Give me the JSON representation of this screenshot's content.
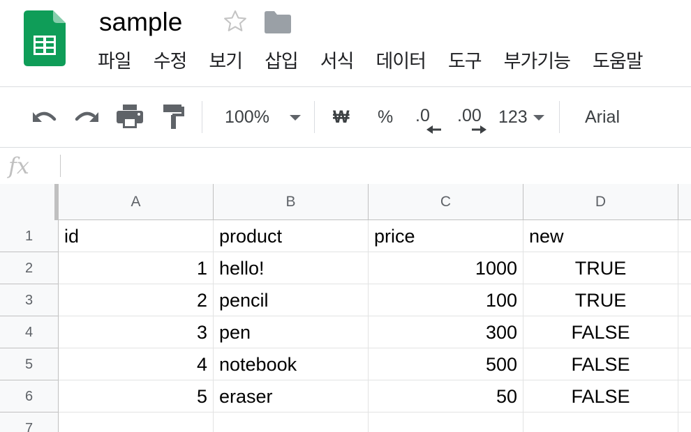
{
  "document": {
    "title": "sample"
  },
  "menu": [
    "파일",
    "수정",
    "보기",
    "삽입",
    "서식",
    "데이터",
    "도구",
    "부가기능",
    "도움말"
  ],
  "toolbar": {
    "zoom": "100%",
    "currency": "₩",
    "percent": "%",
    "decrease_decimal": ".0",
    "increase_decimal": ".00",
    "number_format": "123",
    "font": "Arial"
  },
  "formula_bar": {
    "label": "fx",
    "value": ""
  },
  "grid": {
    "columns": [
      "A",
      "B",
      "C",
      "D"
    ],
    "rows": [
      "1",
      "2",
      "3",
      "4",
      "5",
      "6",
      "7"
    ],
    "cells": [
      [
        "id",
        "product",
        "price",
        "new"
      ],
      [
        "1",
        "hello!",
        "1000",
        "TRUE"
      ],
      [
        "2",
        "pencil",
        "100",
        "TRUE"
      ],
      [
        "3",
        "pen",
        "300",
        "FALSE"
      ],
      [
        "4",
        "notebook",
        "500",
        "FALSE"
      ],
      [
        "5",
        "eraser",
        "50",
        "FALSE"
      ],
      [
        "",
        "",
        "",
        ""
      ]
    ]
  },
  "colors": {
    "brand_green": "#0f9d58",
    "icon_gray": "#5f6368",
    "header_bg": "#f8f9fa",
    "grid_line": "#e2e3e3"
  }
}
